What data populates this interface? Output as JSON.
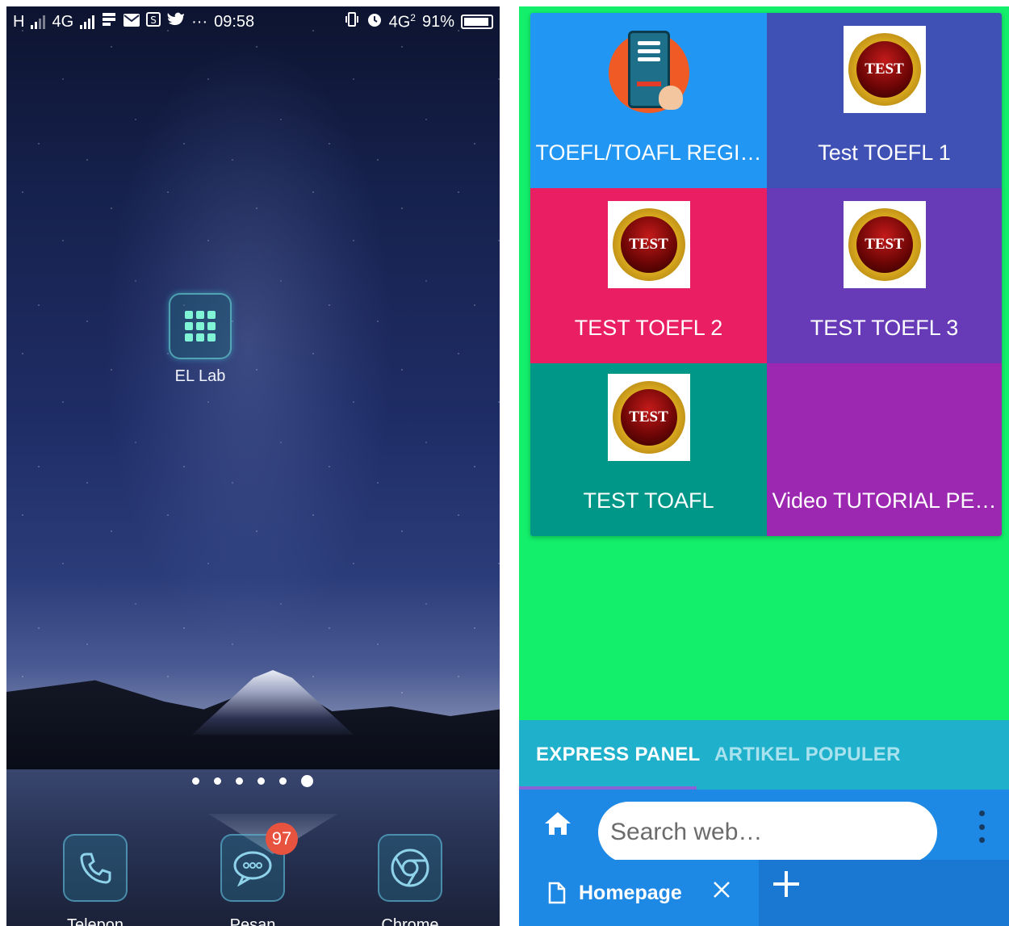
{
  "left_phone": {
    "status_bar": {
      "network_left": "H",
      "network_mid": "4G",
      "more": "···",
      "time": "09:58",
      "network_right": "4G",
      "sim_index": "2",
      "battery": "91%"
    },
    "home_app": {
      "label": "EL Lab",
      "icon": "grid-app-icon"
    },
    "page_indicator": {
      "count": 6,
      "active_index": 5
    },
    "dock": [
      {
        "label": "Telepon",
        "icon": "phone-icon"
      },
      {
        "label": "Pesan",
        "icon": "message-icon",
        "badge": "97"
      },
      {
        "label": "Chrome",
        "icon": "chrome-icon"
      }
    ]
  },
  "right_phone": {
    "tiles": [
      {
        "label": "TOEFL/TOAFL REGI…",
        "color": "#2196f3",
        "image": "register-tablet-image"
      },
      {
        "label": "Test TOEFL 1",
        "color": "#3f51b5",
        "image": "test-medal-image",
        "image_text": "TEST"
      },
      {
        "label": "TEST TOEFL 2",
        "color": "#e91e63",
        "image": "test-medal-image",
        "image_text": "TEST"
      },
      {
        "label": "TEST TOEFL 3",
        "color": "#673ab7",
        "image": "test-medal-image",
        "image_text": "TEST"
      },
      {
        "label": "TEST TOAFL",
        "color": "#009688",
        "image": "test-medal-image",
        "image_text": "TEST"
      },
      {
        "label": "Video TUTORIAL PE…",
        "color": "#9c27b0",
        "image": ""
      }
    ],
    "background_color": "#13ef6b",
    "section_tabs": [
      {
        "label": "EXPRESS PANEL",
        "active": true
      },
      {
        "label": "ARTIKEL POPULER",
        "active": false
      }
    ],
    "search": {
      "placeholder": "Search web…",
      "value": ""
    },
    "browser_tab": {
      "title": "Homepage"
    },
    "colors": {
      "tabbar": "#1fb1cb",
      "toolbar": "#1e88e5",
      "indicator": "#8a64d6"
    }
  }
}
